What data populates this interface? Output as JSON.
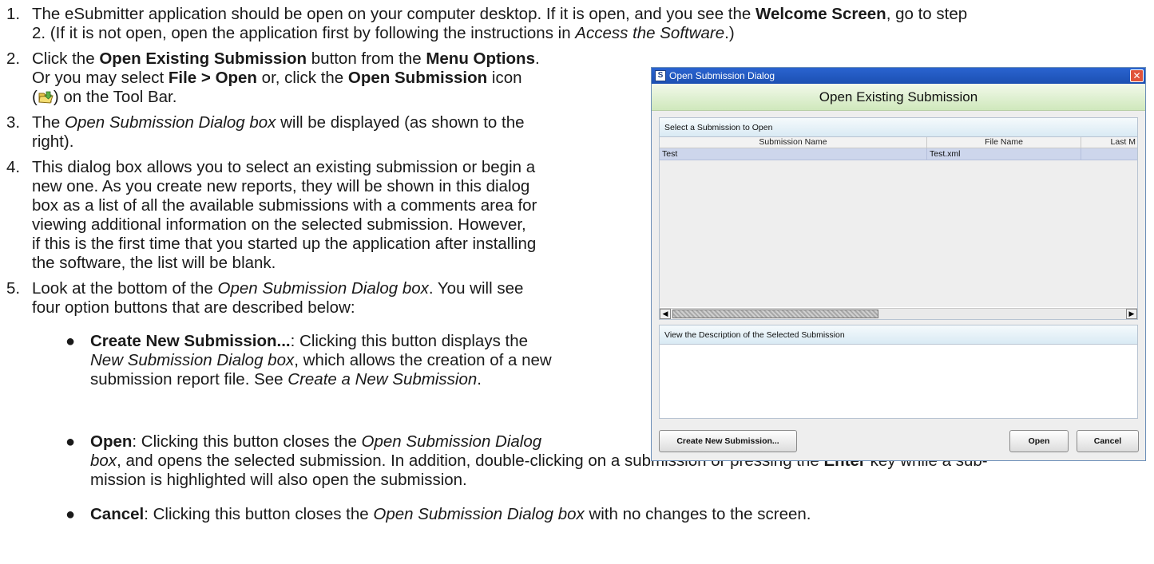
{
  "steps": [
    {
      "number": "1.",
      "line1": [
        "The eSubmitter application should be open on your computer desktop. If it is open, and you see the ",
        "Welcome Screen",
        ", go to step"
      ],
      "line2": [
        "2. (If it is not open, open the application first by following the instructions in ",
        "Access the Software",
        ".)"
      ]
    },
    {
      "number": "2.",
      "line1": [
        "Click the ",
        "Open Existing Submission",
        " button from the ",
        "Menu Options",
        "."
      ],
      "line2": [
        "Or you may select ",
        "File > Open",
        " or, click the ",
        "Open Submission",
        " icon"
      ],
      "line3": [
        "(",
        ") on the Tool Bar."
      ]
    },
    {
      "number": "3.",
      "line1": [
        "The ",
        "Open Submission Dialog box",
        " will be displayed (as shown to the"
      ],
      "line2": "right)."
    },
    {
      "number": "4.",
      "lines": [
        "This dialog box allows you to select an existing submission or begin a",
        "new one. As you create new reports, they will be shown in this dialog",
        "box as a list of all the available submissions with a comments area for",
        "viewing additional information on the selected submission.  However,",
        "if this is the first time that you started up the application after installing",
        "the software, the list will be blank."
      ]
    },
    {
      "number": "5.",
      "line1": [
        "Look at the bottom of the ",
        "Open Submission Dialog box",
        ". You will see"
      ],
      "line2": "four option buttons that are described below:"
    }
  ],
  "bullets": [
    {
      "line1": [
        "Create New Submission...",
        ": Clicking this button displays the"
      ],
      "line2": [
        "New Submission Dialog box",
        ", which allows the creation of a new"
      ],
      "line3": [
        "submission report file. See ",
        "Create a New Submission",
        "."
      ]
    },
    {
      "line1": [
        "Open",
        ": Clicking this button closes the ",
        "Open Submission Dialog"
      ],
      "line2": [
        "box",
        ", and opens the selected submission. In addition, double-clicking on a submission or pressing the ",
        "Enter",
        " key while a sub-"
      ],
      "line3": "mission is highlighted will also open the submission."
    },
    {
      "line1": [
        "Cancel",
        ": Clicking this button closes the ",
        "Open Submission Dialog box",
        " with no changes to the screen."
      ]
    }
  ],
  "dialog": {
    "title": "Open Submission Dialog",
    "app_icon_letter": "S",
    "close_glyph": "✕",
    "header": "Open Existing Submission",
    "list_panel_title": "Select a Submission to Open",
    "columns": [
      "Submission Name",
      "File Name",
      "Last M"
    ],
    "rows": [
      {
        "name": "Test",
        "file": "Test.xml",
        "last": ""
      }
    ],
    "scroll_left_glyph": "◀",
    "scroll_right_glyph": "▶",
    "description_title": "View the Description of the Selected Submission",
    "buttons": {
      "create": "Create New Submission...",
      "open": "Open",
      "cancel": "Cancel"
    }
  },
  "colors": {
    "title_bar": "#1c4fb2",
    "header_green": "#cfe8bc",
    "selected_row": "#cdd6ec",
    "close_button": "#e0533a"
  },
  "icons": [
    "open-submission-folder-icon",
    "close-icon",
    "app-icon"
  ]
}
